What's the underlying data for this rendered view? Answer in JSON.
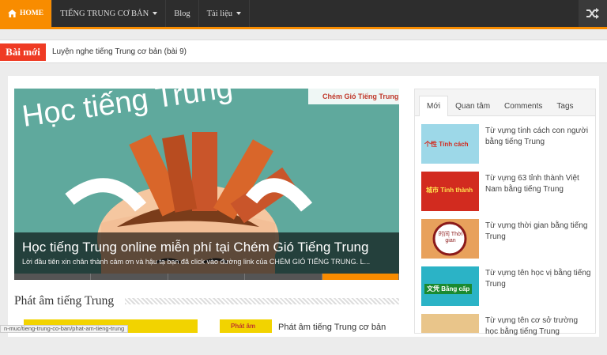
{
  "nav": {
    "items": [
      {
        "label": "HOME",
        "active": true
      },
      {
        "label": "TIẾNG TRUNG CƠ BẢN",
        "dropdown": true
      },
      {
        "label": "Blog"
      },
      {
        "label": "Tài liệu",
        "dropdown": true
      }
    ]
  },
  "breaking": {
    "label": "Bài mới",
    "headline": "Luyện nghe tiếng Trung cơ bản (bài 9)"
  },
  "slider": {
    "title": "Học tiếng Trung online miễn phí tại Chém Gió Tiếng Trung",
    "excerpt": "Lời đầu tiên xin chân thành cảm ơn và hậu tạ bạn đã click vào đường link của CHÉM GIÓ TIẾNG TRUNG. L...",
    "image_text": "Học tiếng Trung",
    "logo_text": "Chém Gió Tiếng Trung"
  },
  "section": {
    "title": "Phát âm tiếng Trung",
    "post_title": "Phát âm tiếng Trung cơ bản",
    "thumb_text": "Phát âm"
  },
  "status_url": "n-muc/tieng-trung-co-ban/phat-am-tieng-trung",
  "sidebar": {
    "tabs": [
      {
        "label": "Mới",
        "active": true
      },
      {
        "label": "Quan tâm"
      },
      {
        "label": "Comments"
      },
      {
        "label": "Tags"
      }
    ],
    "items": [
      {
        "title": "Từ vựng tính cách con người bằng tiếng Trung",
        "thumb_text": "个性 Tính cách",
        "color": "#9dd8e8"
      },
      {
        "title": "Từ vựng 63 tỉnh thành Việt Nam bằng tiếng Trung",
        "thumb_text": "城市 Tỉnh thành",
        "color": "#d22b1f"
      },
      {
        "title": "Từ vựng thời gian bằng tiếng Trung",
        "thumb_text": "时间 Thời gian",
        "color": "#e8a15c"
      },
      {
        "title": "Từ vựng tên học vị bằng tiếng Trung",
        "thumb_text": "文凭 Bằng cấp",
        "color": "#2bb3c6"
      },
      {
        "title": "Từ vựng tên cơ sở trường học bằng tiếng Trung",
        "thumb_text": "",
        "color": "#e9c58a"
      }
    ]
  },
  "colors": {
    "accent": "#f88c00",
    "breaking": "#ef3b24",
    "nav_bg": "#2d2d2d"
  }
}
